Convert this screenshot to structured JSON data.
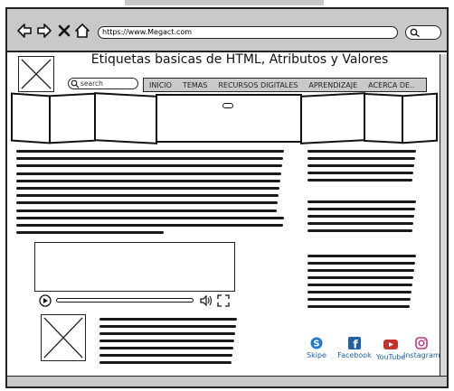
{
  "browser": {
    "url": "https://www.Megact.com"
  },
  "page": {
    "title": "Etiquetas basicas de HTML, Atributos y Valores",
    "search_placeholder": "search",
    "menu": [
      "INICIO",
      "TEMAS",
      "RECURSOS DIGITALES",
      "APRENDIZAJE",
      "ACERCA DE.."
    ]
  },
  "social": [
    {
      "label": "Skipe",
      "icon": "skype-icon",
      "color": "#1f78d1"
    },
    {
      "label": "Facebook",
      "icon": "facebook-icon",
      "color": "#1f5fa8"
    },
    {
      "label": "YouTube",
      "icon": "youtube-icon",
      "color": "#c4302b"
    },
    {
      "label": "Instagram",
      "icon": "instagram-icon",
      "color": "#c13584"
    }
  ]
}
